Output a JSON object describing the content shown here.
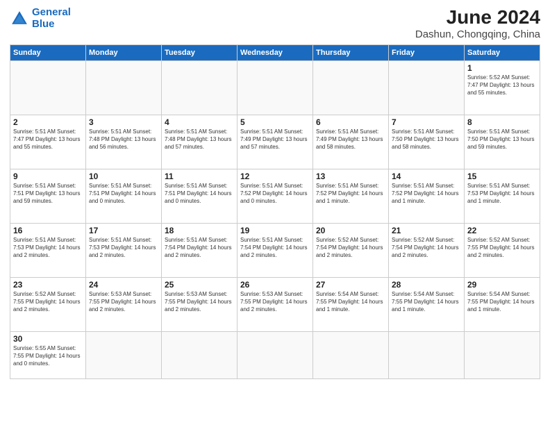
{
  "header": {
    "logo_general": "General",
    "logo_blue": "Blue",
    "month_title": "June 2024",
    "subtitle": "Dashun, Chongqing, China"
  },
  "weekdays": [
    "Sunday",
    "Monday",
    "Tuesday",
    "Wednesday",
    "Thursday",
    "Friday",
    "Saturday"
  ],
  "weeks": [
    [
      {
        "day": "",
        "info": ""
      },
      {
        "day": "",
        "info": ""
      },
      {
        "day": "",
        "info": ""
      },
      {
        "day": "",
        "info": ""
      },
      {
        "day": "",
        "info": ""
      },
      {
        "day": "",
        "info": ""
      },
      {
        "day": "1",
        "info": "Sunrise: 5:52 AM\nSunset: 7:47 PM\nDaylight: 13 hours\nand 55 minutes."
      }
    ],
    [
      {
        "day": "2",
        "info": "Sunrise: 5:51 AM\nSunset: 7:47 PM\nDaylight: 13 hours\nand 55 minutes."
      },
      {
        "day": "3",
        "info": "Sunrise: 5:51 AM\nSunset: 7:48 PM\nDaylight: 13 hours\nand 56 minutes."
      },
      {
        "day": "4",
        "info": "Sunrise: 5:51 AM\nSunset: 7:48 PM\nDaylight: 13 hours\nand 57 minutes."
      },
      {
        "day": "5",
        "info": "Sunrise: 5:51 AM\nSunset: 7:49 PM\nDaylight: 13 hours\nand 57 minutes."
      },
      {
        "day": "6",
        "info": "Sunrise: 5:51 AM\nSunset: 7:49 PM\nDaylight: 13 hours\nand 58 minutes."
      },
      {
        "day": "7",
        "info": "Sunrise: 5:51 AM\nSunset: 7:50 PM\nDaylight: 13 hours\nand 58 minutes."
      },
      {
        "day": "8",
        "info": "Sunrise: 5:51 AM\nSunset: 7:50 PM\nDaylight: 13 hours\nand 59 minutes."
      }
    ],
    [
      {
        "day": "9",
        "info": "Sunrise: 5:51 AM\nSunset: 7:51 PM\nDaylight: 13 hours\nand 59 minutes."
      },
      {
        "day": "10",
        "info": "Sunrise: 5:51 AM\nSunset: 7:51 PM\nDaylight: 14 hours\nand 0 minutes."
      },
      {
        "day": "11",
        "info": "Sunrise: 5:51 AM\nSunset: 7:51 PM\nDaylight: 14 hours\nand 0 minutes."
      },
      {
        "day": "12",
        "info": "Sunrise: 5:51 AM\nSunset: 7:52 PM\nDaylight: 14 hours\nand 0 minutes."
      },
      {
        "day": "13",
        "info": "Sunrise: 5:51 AM\nSunset: 7:52 PM\nDaylight: 14 hours\nand 1 minute."
      },
      {
        "day": "14",
        "info": "Sunrise: 5:51 AM\nSunset: 7:52 PM\nDaylight: 14 hours\nand 1 minute."
      },
      {
        "day": "15",
        "info": "Sunrise: 5:51 AM\nSunset: 7:53 PM\nDaylight: 14 hours\nand 1 minute."
      }
    ],
    [
      {
        "day": "16",
        "info": "Sunrise: 5:51 AM\nSunset: 7:53 PM\nDaylight: 14 hours\nand 2 minutes."
      },
      {
        "day": "17",
        "info": "Sunrise: 5:51 AM\nSunset: 7:53 PM\nDaylight: 14 hours\nand 2 minutes."
      },
      {
        "day": "18",
        "info": "Sunrise: 5:51 AM\nSunset: 7:54 PM\nDaylight: 14 hours\nand 2 minutes."
      },
      {
        "day": "19",
        "info": "Sunrise: 5:51 AM\nSunset: 7:54 PM\nDaylight: 14 hours\nand 2 minutes."
      },
      {
        "day": "20",
        "info": "Sunrise: 5:52 AM\nSunset: 7:54 PM\nDaylight: 14 hours\nand 2 minutes."
      },
      {
        "day": "21",
        "info": "Sunrise: 5:52 AM\nSunset: 7:54 PM\nDaylight: 14 hours\nand 2 minutes."
      },
      {
        "day": "22",
        "info": "Sunrise: 5:52 AM\nSunset: 7:55 PM\nDaylight: 14 hours\nand 2 minutes."
      }
    ],
    [
      {
        "day": "23",
        "info": "Sunrise: 5:52 AM\nSunset: 7:55 PM\nDaylight: 14 hours\nand 2 minutes."
      },
      {
        "day": "24",
        "info": "Sunrise: 5:53 AM\nSunset: 7:55 PM\nDaylight: 14 hours\nand 2 minutes."
      },
      {
        "day": "25",
        "info": "Sunrise: 5:53 AM\nSunset: 7:55 PM\nDaylight: 14 hours\nand 2 minutes."
      },
      {
        "day": "26",
        "info": "Sunrise: 5:53 AM\nSunset: 7:55 PM\nDaylight: 14 hours\nand 2 minutes."
      },
      {
        "day": "27",
        "info": "Sunrise: 5:54 AM\nSunset: 7:55 PM\nDaylight: 14 hours\nand 1 minute."
      },
      {
        "day": "28",
        "info": "Sunrise: 5:54 AM\nSunset: 7:55 PM\nDaylight: 14 hours\nand 1 minute."
      },
      {
        "day": "29",
        "info": "Sunrise: 5:54 AM\nSunset: 7:55 PM\nDaylight: 14 hours\nand 1 minute."
      }
    ],
    [
      {
        "day": "30",
        "info": "Sunrise: 5:55 AM\nSunset: 7:55 PM\nDaylight: 14 hours\nand 0 minutes."
      },
      {
        "day": "",
        "info": ""
      },
      {
        "day": "",
        "info": ""
      },
      {
        "day": "",
        "info": ""
      },
      {
        "day": "",
        "info": ""
      },
      {
        "day": "",
        "info": ""
      },
      {
        "day": "",
        "info": ""
      }
    ]
  ]
}
